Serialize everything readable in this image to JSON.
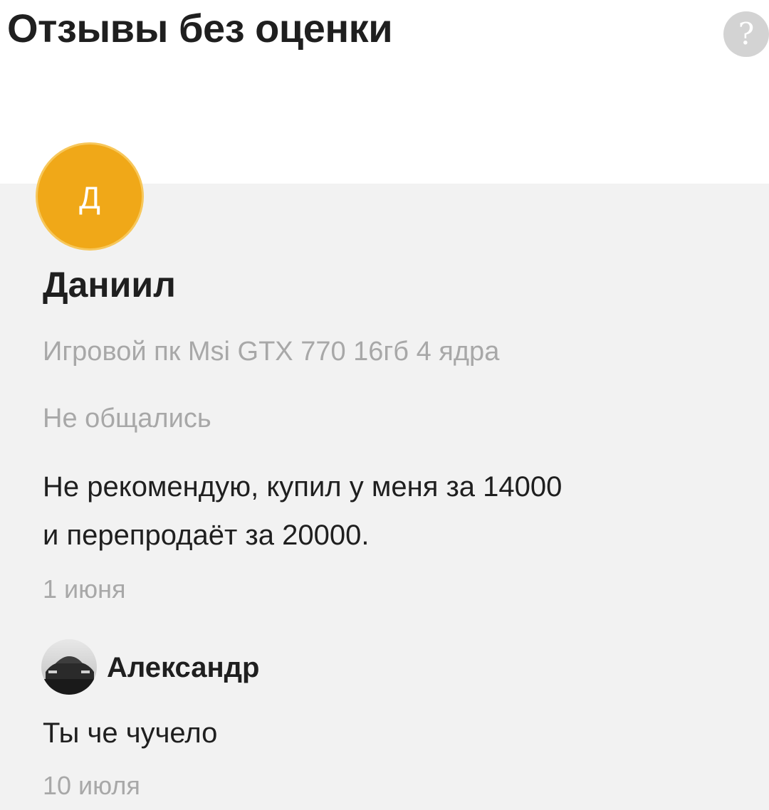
{
  "header": {
    "title": "Отзывы без оценки",
    "help_label": "?"
  },
  "review": {
    "avatar_letter": "Д",
    "author": "Даниил",
    "product": "Игровой пк Msi GTX 770 16гб 4 ядра",
    "status": "Не общались",
    "text_lines": [
      "Не рекомендую, купил у меня за 14000",
      "и перепродаёт за 20000."
    ],
    "date": "1 июня"
  },
  "reply": {
    "author": "Александр",
    "text": "Ты че чучело",
    "date": "10 июля"
  },
  "colors": {
    "avatar_accent": "#f0a818",
    "card_background": "#f2f2f2",
    "muted_text": "#a8a8a8"
  }
}
